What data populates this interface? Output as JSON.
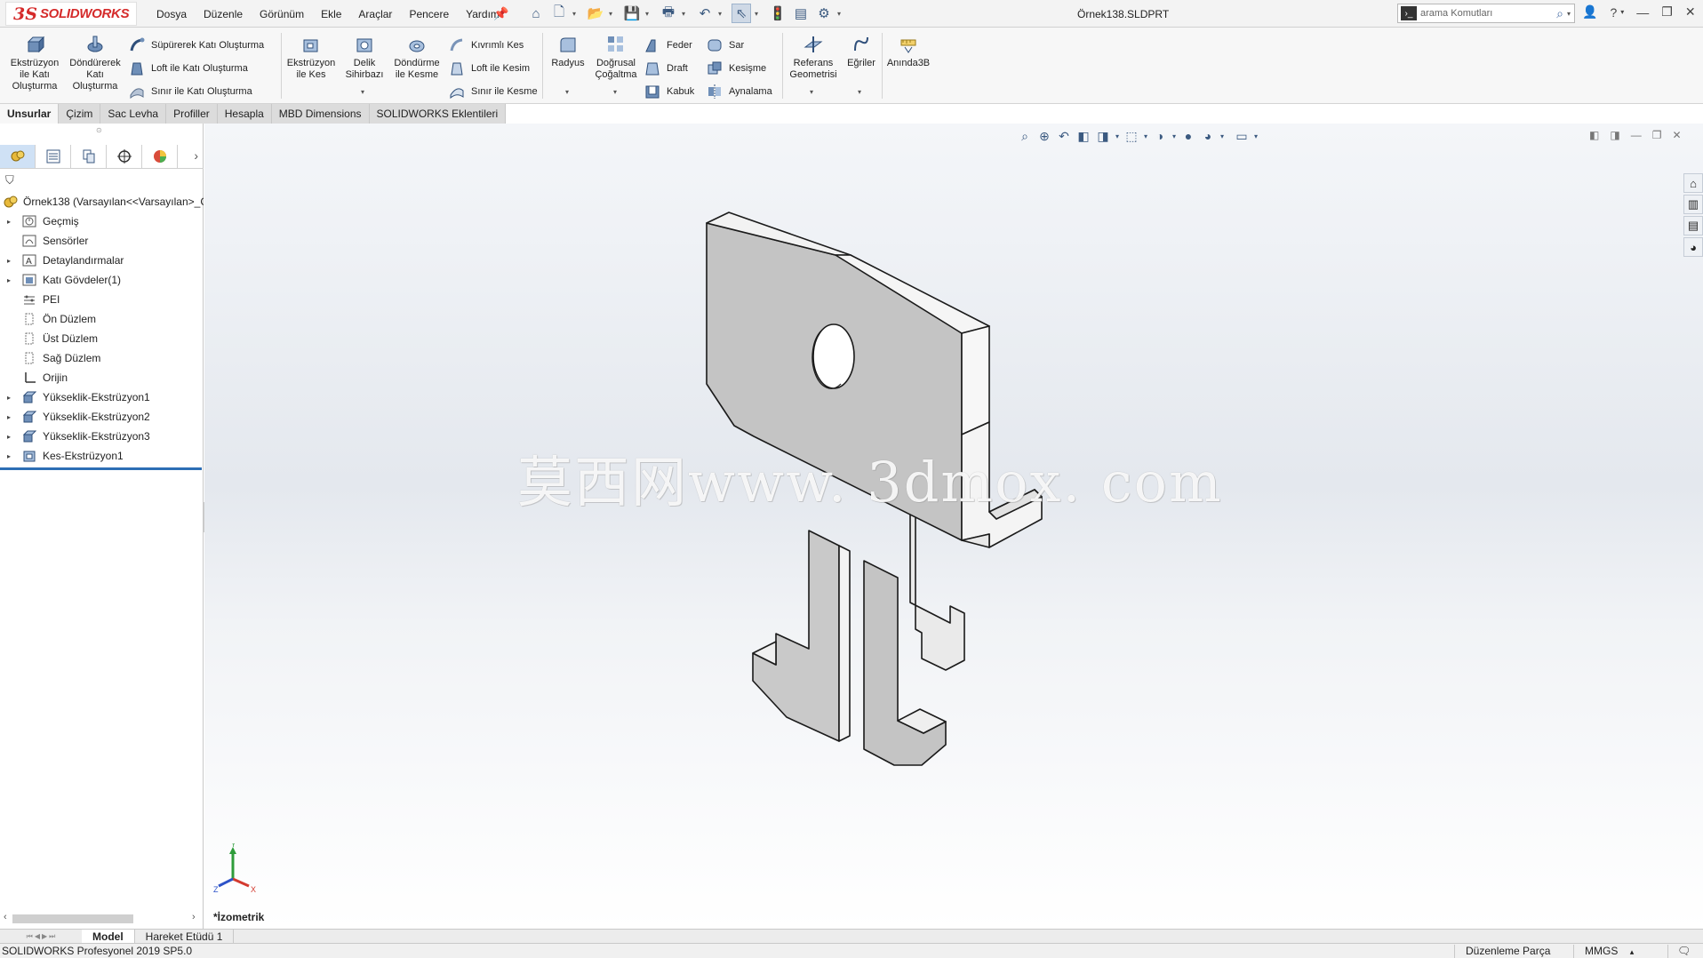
{
  "app": {
    "brand_ds": "3S",
    "brand_name": "SOLIDWORKS",
    "document_title": "Örnek138.SLDPRT"
  },
  "menu": [
    "Dosya",
    "Düzenle",
    "Görünüm",
    "Ekle",
    "Araçlar",
    "Pencere",
    "Yardım"
  ],
  "search": {
    "placeholder": "arama Komutları"
  },
  "ribbon": {
    "extrude_boss": "Ekstrüzyon ile Katı Oluşturma",
    "revolve_boss": "Döndürerek Katı Oluşturma",
    "swept_boss": "Süpürerek Katı Oluşturma",
    "loft_boss": "Loft ile Katı Oluşturma",
    "boundary_boss": "Sınır ile Katı Oluşturma",
    "extrude_cut": "Ekstrüzyon ile Kes",
    "hole_wizard": "Delik Sihirbazı",
    "revolve_cut": "Döndürme ile Kesme",
    "swept_cut": "Kıvrımlı Kes",
    "loft_cut": "Loft ile Kesim",
    "boundary_cut": "Sınır ile Kesme",
    "fillet": "Radyus",
    "linear_pattern": "Doğrusal Çoğaltma",
    "rib": "Feder",
    "draft": "Draft",
    "shell": "Kabuk",
    "wrap": "Sar",
    "intersect": "Kesişme",
    "mirror": "Aynalama",
    "ref_geometry": "Referans Geometrisi",
    "curves": "Eğriler",
    "instant3d": "Anında3B"
  },
  "tabs": [
    "Unsurlar",
    "Çizim",
    "Sac Levha",
    "Profiller",
    "Hesapla",
    "MBD Dimensions",
    "SOLIDWORKS Eklentileri"
  ],
  "tree": {
    "root": "Örnek138  (Varsayılan<<Varsayılan>_G",
    "items": [
      "Geçmiş",
      "Sensörler",
      "Detaylandırmalar",
      "Katı Gövdeler(1)",
      "PEI",
      "Ön Düzlem",
      "Üst Düzlem",
      "Sağ Düzlem",
      "Orijin",
      "Yükseklik-Ekstrüzyon1",
      "Yükseklik-Ekstrüzyon2",
      "Yükseklik-Ekstrüzyon3",
      "Kes-Ekstrüzyon1"
    ]
  },
  "viewport": {
    "watermark": "莫西网www. 3dmox. com",
    "view_name": "*İzometrik",
    "triad_labels": {
      "y": "Y",
      "x": "X",
      "z": "Z"
    }
  },
  "sheet_tabs": [
    "Model",
    "Hareket Etüdü 1"
  ],
  "status": {
    "version": "SOLIDWORKS Profesyonel 2019 SP5.0",
    "mode": "Düzenleme Parça",
    "units": "MMGS",
    "units_arrow": "▴"
  },
  "colors": {
    "accent": "#2d6eb5",
    "brand": "#d52b2b",
    "part_face": "#c4c4c4"
  }
}
